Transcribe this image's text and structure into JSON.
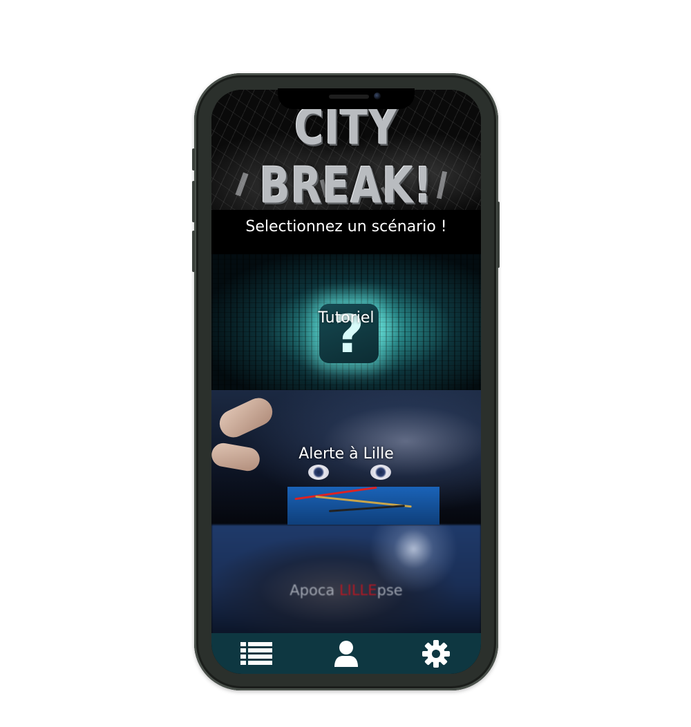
{
  "app": {
    "banner_title": "CITY BREAK!",
    "subtitle": "Selectionnez un scénario !"
  },
  "scenarios": [
    {
      "label": "Tutoriel"
    },
    {
      "label": "Alerte à Lille"
    },
    {
      "label_parts": [
        "Apoca ",
        "LILLE",
        "pse"
      ]
    }
  ],
  "tabbar": {
    "items": [
      {
        "icon": "list-icon"
      },
      {
        "icon": "user-icon"
      },
      {
        "icon": "gear-icon"
      }
    ],
    "background": "#0e3741",
    "icon_color": "#ffffff"
  },
  "colors": {
    "screen_background": "#000000",
    "title_metal": "#b9bcc0",
    "apoca_accent": "#c8141e"
  }
}
